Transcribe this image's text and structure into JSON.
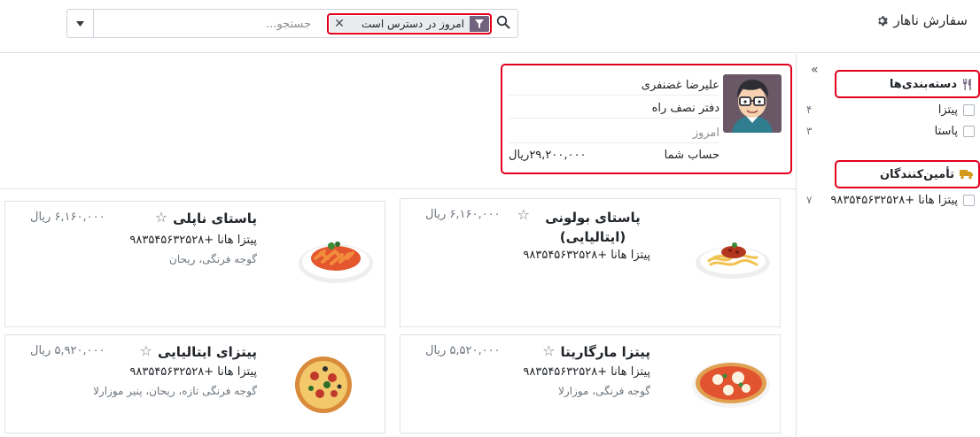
{
  "app": {
    "title": "سفارش ناهار",
    "settings_icon": "gear-icon"
  },
  "search": {
    "placeholder": "جستجو...",
    "value": "",
    "facet_label": "امروز در دسترس است",
    "facet_icon": "filter-icon",
    "remove_icon": "close-icon",
    "search_icon": "search-icon",
    "toggle_icon": "caret-down-icon"
  },
  "sidepanel": {
    "collapse_label": "«",
    "categories": {
      "title": "دسته‌بندی‌ها",
      "icon": "cutlery-icon",
      "items": [
        {
          "label": "پیتزا",
          "count": "۴"
        },
        {
          "label": "پاستا",
          "count": "۳"
        }
      ]
    },
    "suppliers": {
      "title": "تأمین‌کنندگان",
      "icon": "truck-icon",
      "items": [
        {
          "label": "پیتزا هانا +۹۸۳۵۴۵۶۳۲۵۲۸...",
          "count": "۷"
        }
      ]
    }
  },
  "user": {
    "name": "علیرضا غضنفری",
    "location": "دفتر نصف راه",
    "date": "امروز",
    "account_label": "حساب شما",
    "account_value": "۲۹,۲۰۰,۰۰۰ریال"
  },
  "products": [
    {
      "name": "پاستای ناپلی",
      "price": "۶,۱۶۰,۰۰۰ ریال",
      "supplier": "پیتزا هانا +۹۸۳۵۴۵۶۳۲۵۲۸",
      "ingredients": "گوجه فرنگی، ریحان"
    },
    {
      "name": "پاستای بولونی (ایتالیایی)",
      "price": "۶,۱۶۰,۰۰۰ ریال",
      "supplier": "پیتزا هانا +۹۸۳۵۴۵۶۳۲۵۲۸",
      "ingredients": ""
    },
    {
      "name": "پیتزای ایتالیایی",
      "price": "۵,۹۲۰,۰۰۰ ریال",
      "supplier": "پیتزا هانا +۹۸۳۵۴۵۶۳۲۵۲۸",
      "ingredients": "گوجه فرنگی تازه، ریحان، پنیر موزارلا"
    },
    {
      "name": "پیتزا مارگاریتا",
      "price": "۵,۵۲۰,۰۰۰ ریال",
      "supplier": "پیتزا هانا +۹۸۳۵۴۵۶۳۲۵۲۸",
      "ingredients": "گوجه فرنگی، موزارلا"
    }
  ]
}
